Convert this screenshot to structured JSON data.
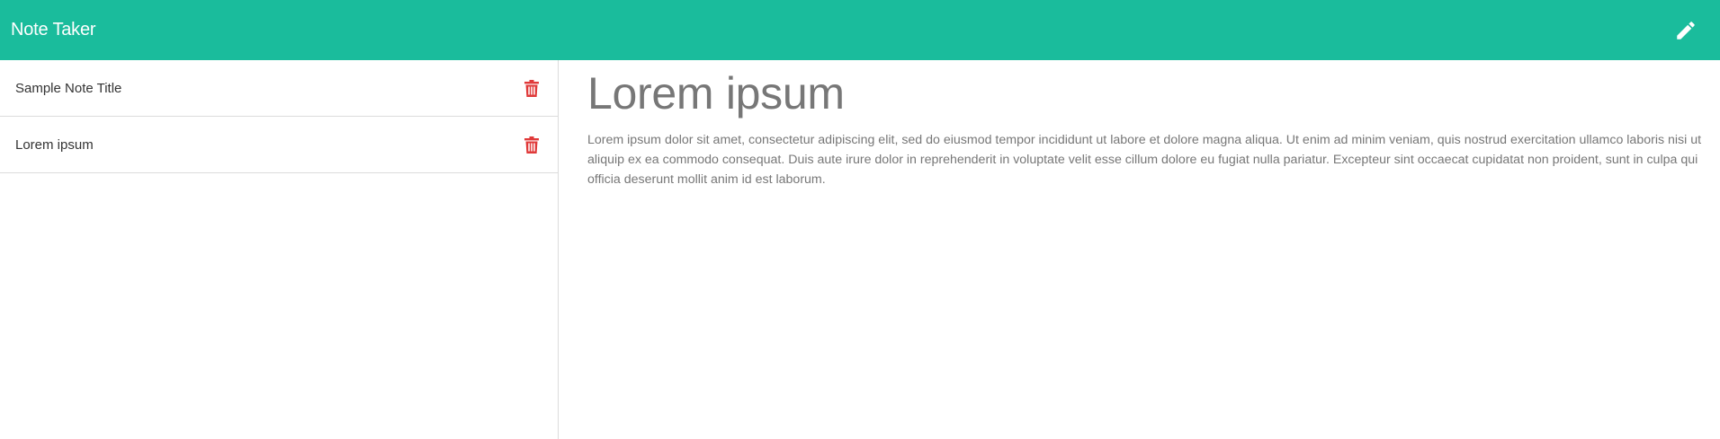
{
  "navbar": {
    "brand": "Note Taker",
    "new_note_icon": "pencil-icon",
    "color": "#1abc9c"
  },
  "sidebar": {
    "notes": [
      {
        "title": "Sample Note Title",
        "delete_icon": "trash-icon"
      },
      {
        "title": "Lorem ipsum",
        "delete_icon": "trash-icon"
      }
    ],
    "delete_color": "#e03a3a"
  },
  "main": {
    "title": "Lorem ipsum",
    "body": "Lorem ipsum dolor sit amet, consectetur adipiscing elit, sed do eiusmod tempor incididunt ut labore et dolore magna aliqua. Ut enim ad minim veniam, quis nostrud exercitation ullamco laboris nisi ut aliquip ex ea commodo consequat. Duis aute irure dolor in reprehenderit in voluptate velit esse cillum dolore eu fugiat nulla pariatur. Excepteur sint occaecat cupidatat non proident, sunt in culpa qui officia deserunt mollit anim id est laborum."
  }
}
